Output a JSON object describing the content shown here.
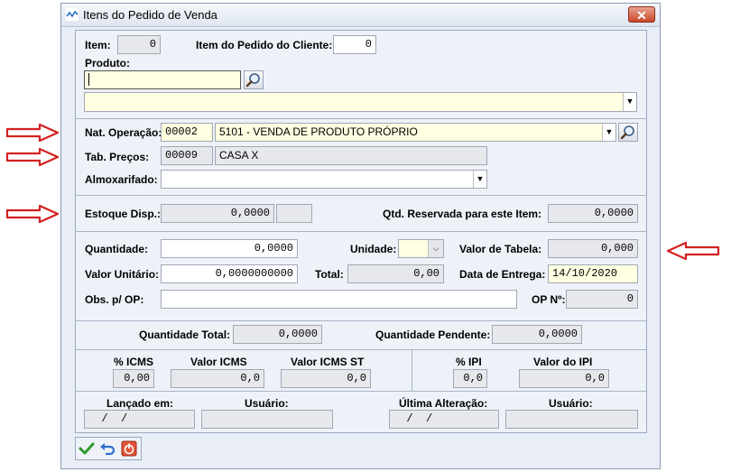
{
  "window": {
    "title": "Itens do Pedido de Venda",
    "close_symbol": "✕"
  },
  "item": {
    "label": "Item:",
    "value": "0"
  },
  "item_cliente": {
    "label": "Item do Pedido do Cliente:",
    "value": "0"
  },
  "produto": {
    "label": "Produto:",
    "code_value": "",
    "description_value": ""
  },
  "nat_operacao": {
    "label": "Nat. Operação:",
    "code": "00002",
    "description": "5101 - VENDA DE PRODUTO PRÓPRIO"
  },
  "tab_precos": {
    "label": "Tab. Preços:",
    "code": "00009",
    "description": "CASA X"
  },
  "almoxarifado": {
    "label": "Almoxarifado:",
    "value": ""
  },
  "estoque": {
    "label": "Estoque Disp.:",
    "value": "0,0000",
    "unit_value": ""
  },
  "qtd_reservada": {
    "label": "Qtd. Reservada para este Item:",
    "value": "0,0000"
  },
  "quantidade": {
    "label": "Quantidade:",
    "value": "0,0000"
  },
  "unidade": {
    "label": "Unidade:",
    "value": ""
  },
  "valor_tabela": {
    "label": "Valor de Tabela:",
    "value": "0,000"
  },
  "valor_unitario": {
    "label": "Valor Unitário:",
    "value": "0,0000000000"
  },
  "total": {
    "label": "Total:",
    "value": "0,00"
  },
  "data_entrega": {
    "label": "Data de Entrega:",
    "value": "14/10/2020"
  },
  "obs_op": {
    "label": "Obs. p/ OP:",
    "value": ""
  },
  "op_no": {
    "label": "OP Nº:",
    "value": "0"
  },
  "quantidade_total": {
    "label": "Quantidade Total:",
    "value": "0,0000"
  },
  "quantidade_pendente": {
    "label": "Quantidade Pendente:",
    "value": "0,0000"
  },
  "icms_pct": {
    "label": "% ICMS",
    "value": "0,00"
  },
  "valor_icms": {
    "label": "Valor ICMS",
    "value": "0,0"
  },
  "valor_icms_st": {
    "label": "Valor ICMS ST",
    "value": "0,0"
  },
  "ipi_pct": {
    "label": "% IPI",
    "value": "0,0"
  },
  "valor_ipi": {
    "label": "Valor do IPI",
    "value": "0,0"
  },
  "lancado_em": {
    "label": "Lançado em:",
    "value": "  /  /"
  },
  "usuario1": {
    "label": "Usuário:",
    "value": ""
  },
  "ultima_alteracao": {
    "label": "Última Alteração:",
    "value": "  /  /"
  },
  "usuario2": {
    "label": "Usuário:",
    "value": ""
  },
  "icons": {
    "search": "magnifier-icon",
    "dropdown": "chevron-down-icon",
    "confirm": "checkmark-icon",
    "undo": "undo-icon",
    "cancel": "power-cancel-icon",
    "annotation": "red-arrow-icon"
  },
  "colors": {
    "highlight_yellow": "#ffffe1",
    "readonly_gray": "#e6e8ec",
    "annotation_red": "#d32020"
  }
}
